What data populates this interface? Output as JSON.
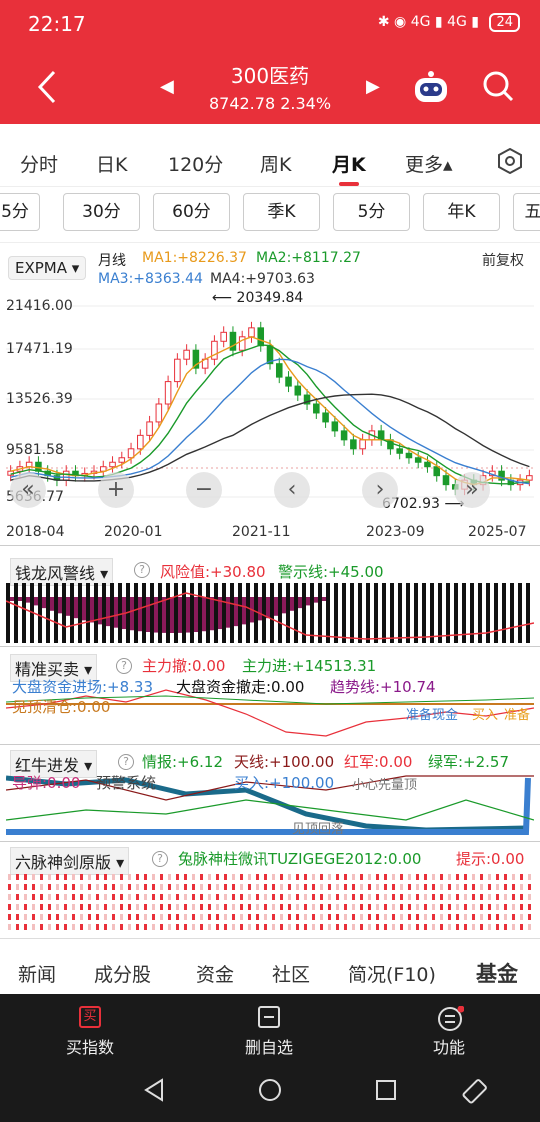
{
  "status": {
    "time": "22:17",
    "icons": "✱ ◉ 4G ▮ 4G ▮",
    "battery": "24"
  },
  "header": {
    "title": "300医药",
    "subtitle": "8742.78  2.34%"
  },
  "tabs": [
    "分时",
    "日K",
    "120分",
    "周K",
    "月K",
    "更多▴"
  ],
  "periods": [
    "5分",
    "30分",
    "60分",
    "季K",
    "5分",
    "年K",
    "五"
  ],
  "main_chart": {
    "indicator": "EXPMA",
    "label": "月线",
    "ma1": "MA1:+8226.37",
    "ma2": "MA2:+8117.27",
    "ma3": "MA3:+8363.44",
    "ma4": "MA4:+9703.63",
    "adjust": "前复权",
    "y_ticks": [
      "21416.00",
      "17471.19",
      "13526.39",
      "9581.58",
      "5636.77"
    ],
    "x_ticks": [
      "2018-04",
      "2020-01",
      "2021-11",
      "2023-09",
      "2025-07"
    ],
    "high_label": "20349.84",
    "low_label": "6702.93",
    "colors": {
      "ma1": "#e89a1c",
      "ma2": "#1a9a2a",
      "ma3": "#3a7fd0",
      "ma4": "#333333",
      "up": "#e8303a",
      "down": "#1a9a2a"
    }
  },
  "panels": {
    "qlfj": {
      "name": "钱龙风警线",
      "v1": "风险值:+30.80",
      "v2": "警示线:+45.00"
    },
    "zjmm": {
      "name": "精准买卖",
      "v1": "主力撤:0.00",
      "v2": "主力进:+14513.31",
      "v3": "大盘资金进场:+8.33",
      "v4": "大盘资金撤走:0.00",
      "v5": "趋势线:+10.74",
      "v6": "见顶清仓:0.00",
      "v7": "准备现金",
      "v8": "买入",
      "v9": "准备"
    },
    "hnjf": {
      "name": "红牛进发",
      "v1": "情报:+6.12",
      "v2": "天线:+100.00",
      "v3": "红军:0.00",
      "v4": "绿军:+2.57",
      "v5": "导弹:0.00",
      "v6": "预警系统",
      "v7": "买入:+100.00",
      "v8": "小心先量顶",
      "v9": "见顶回落"
    },
    "lmsj": {
      "name": "六脉神剑原版",
      "v1": "兔脉神柱微讯TUZIGEGE2012:0.00",
      "v2": "提示:0.00"
    }
  },
  "bottom_tabs": [
    "新闻",
    "成分股",
    "资金",
    "社区",
    "简况(F10)",
    "基金"
  ],
  "actions": [
    "买指数",
    "删自选",
    "功能"
  ]
}
